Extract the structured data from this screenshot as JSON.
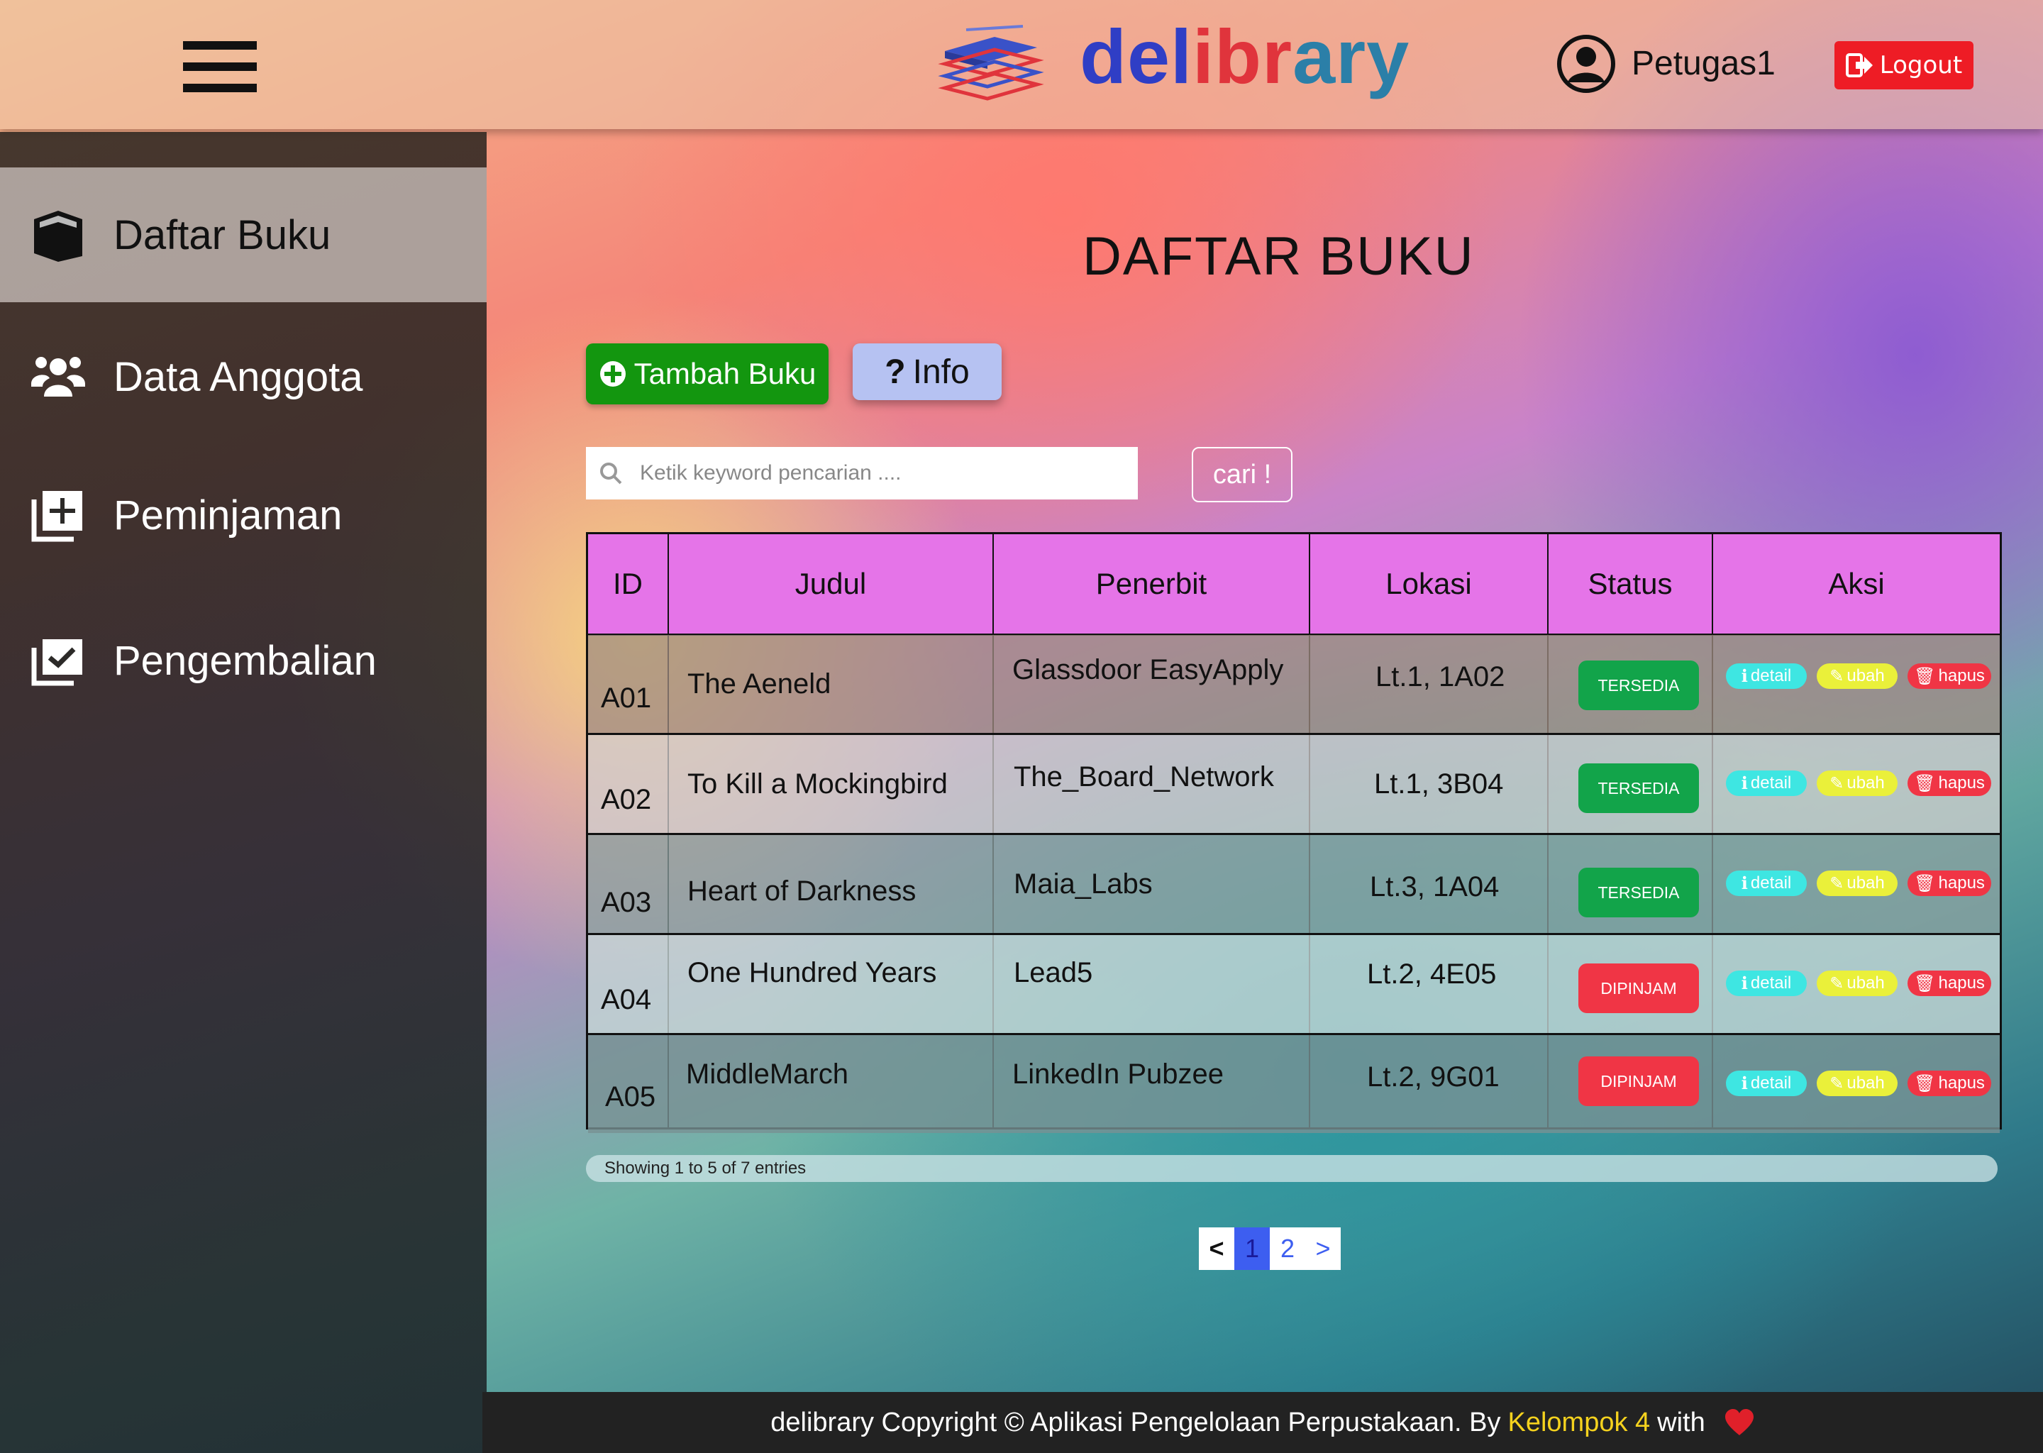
{
  "header": {
    "brand_part1": "del",
    "brand_part2": "ibr",
    "brand_part3": "ary",
    "user_name": "Petugas1",
    "logout_label": "Logout",
    "icons": [
      "menu-icon",
      "logo-books-icon",
      "user-icon",
      "logout-icon"
    ]
  },
  "sidebar": {
    "items": [
      {
        "label": "Daftar Buku",
        "icon": "book-icon",
        "active": true
      },
      {
        "label": "Data Anggota",
        "icon": "users-icon",
        "active": false
      },
      {
        "label": "Peminjaman",
        "icon": "add-library-icon",
        "active": false
      },
      {
        "label": "Pengembalian",
        "icon": "library-check-icon",
        "active": false
      }
    ]
  },
  "main": {
    "title": "DAFTAR BUKU",
    "add_button": "Tambah Buku",
    "info_button": "Info",
    "search_placeholder": "Ketik keyword pencarian ....",
    "search_button": "cari !"
  },
  "table": {
    "headers": [
      "ID",
      "Judul",
      "Penerbit",
      "Lokasi",
      "Status",
      "Aksi"
    ],
    "rows": [
      {
        "id": "A01",
        "judul": "The Aeneld",
        "penerbit": "Glassdoor EasyApply",
        "lokasi": "Lt.1, 1A02",
        "status": "TERSEDIA",
        "status_kind": "ok"
      },
      {
        "id": "A02",
        "judul": "To Kill a Mockingbird",
        "penerbit": "The_Board_Network",
        "lokasi": "Lt.1, 3B04",
        "status": "TERSEDIA",
        "status_kind": "ok"
      },
      {
        "id": "A03",
        "judul": "Heart of Darkness",
        "penerbit": "Maia_Labs",
        "lokasi": "Lt.3, 1A04",
        "status": "TERSEDIA",
        "status_kind": "ok"
      },
      {
        "id": "A04",
        "judul": "One Hundred Years",
        "penerbit": "Lead5",
        "lokasi": "Lt.2, 4E05",
        "status": "DIPINJAM",
        "status_kind": "no"
      },
      {
        "id": "A05",
        "judul": "MiddleMarch",
        "penerbit": "LinkedIn Pubzee",
        "lokasi": "Lt.2, 9G01",
        "status": "DIPINJAM",
        "status_kind": "no"
      }
    ],
    "actions": {
      "detail": "detail",
      "ubah": "ubah",
      "hapus": "hapus"
    }
  },
  "showing_text": "Showing 1 to 5 of 7 entries",
  "pagination": {
    "prev": "<",
    "pages": [
      "1",
      "2"
    ],
    "current": "1",
    "next": ">"
  },
  "footer": {
    "text_before": "delibrary Copyright © Aplikasi Pengelolaan Perpustakaan. By",
    "group": "Kelompok 4",
    "text_after": "with"
  },
  "colors": {
    "header_bg": "#ebc8aa",
    "table_header": "#e574e8",
    "available": "#12a44a",
    "borrowed": "#f03545",
    "add_button": "#13960f",
    "info_button": "#b6c2f2",
    "logout": "#ee1c25",
    "group_highlight": "#f5d21e"
  }
}
